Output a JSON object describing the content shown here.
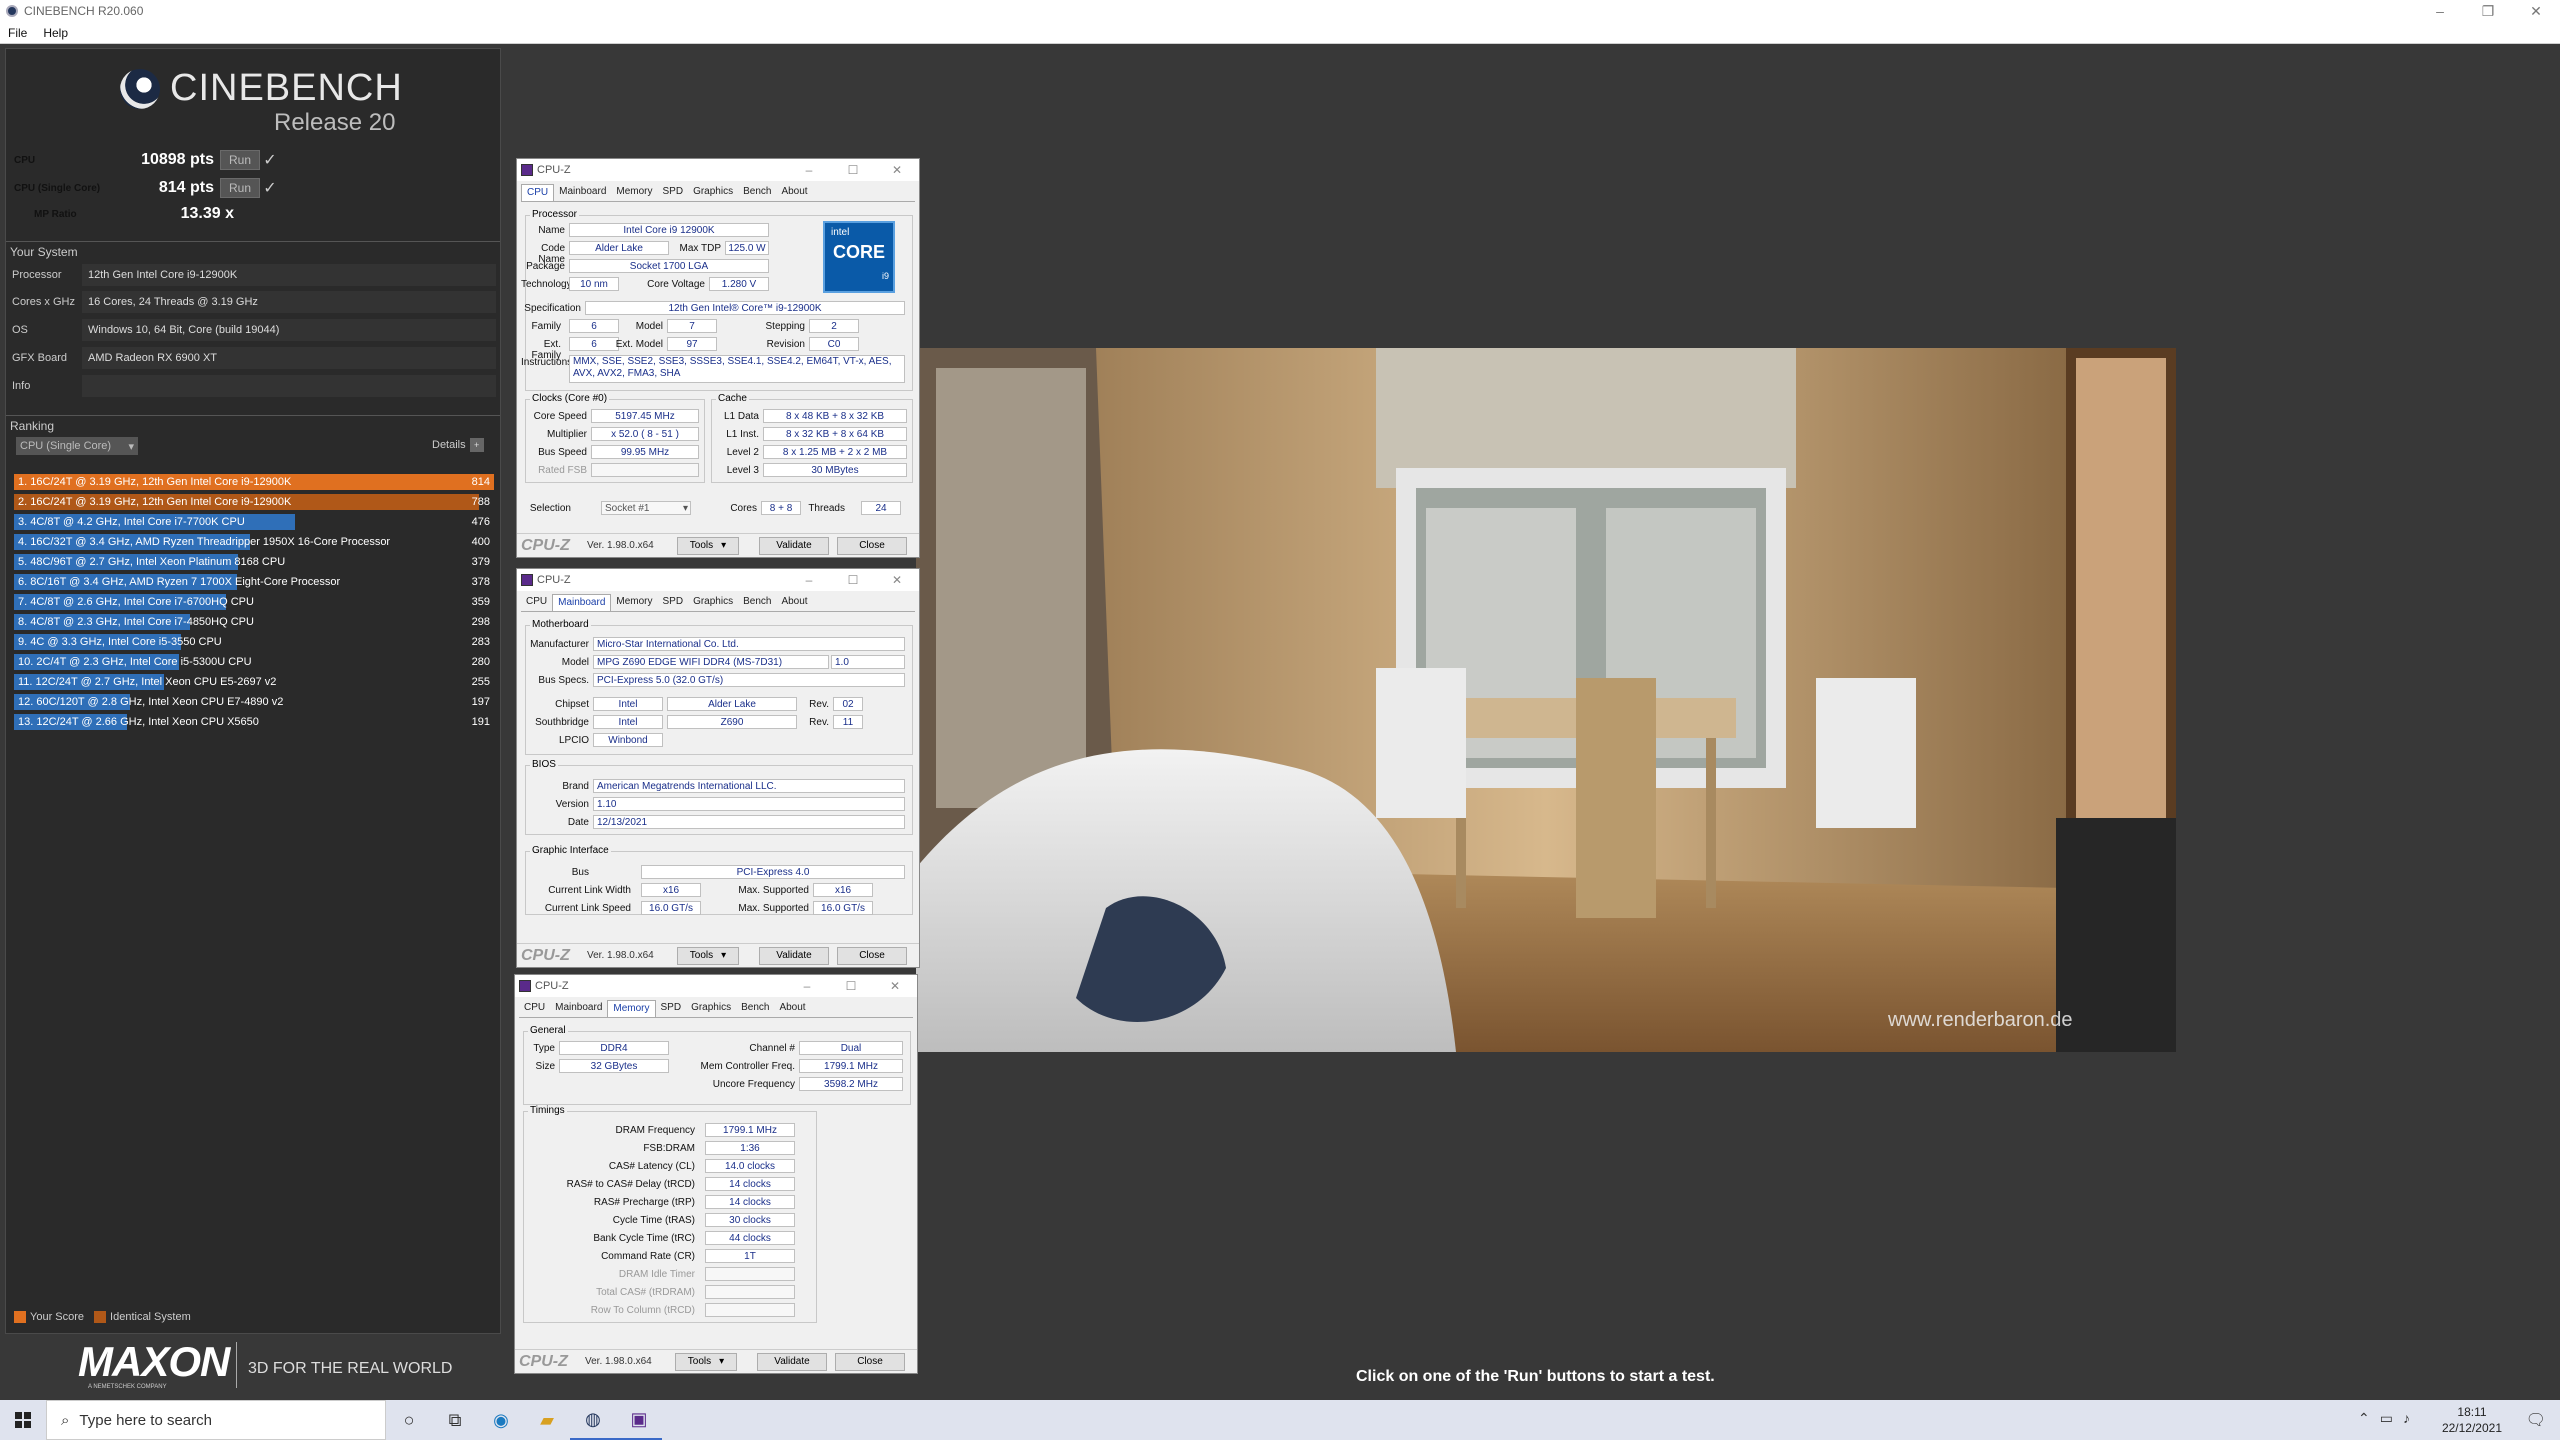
{
  "window": {
    "title": "CINEBENCH R20.060",
    "menu": [
      "File",
      "Help"
    ]
  },
  "cinebench": {
    "logo_title": "CINEBENCH",
    "logo_release": "Release 20",
    "cpu": {
      "label": "CPU",
      "value": "10898 pts",
      "run": "Run"
    },
    "single": {
      "label": "CPU (Single Core)",
      "value": "814 pts",
      "run": "Run"
    },
    "mp": {
      "label": "MP Ratio",
      "value": "13.39 x"
    },
    "your_system": "Your System",
    "system": [
      {
        "k": "Processor",
        "v": "12th Gen Intel Core i9-12900K"
      },
      {
        "k": "Cores x GHz",
        "v": "16 Cores, 24 Threads @ 3.19 GHz"
      },
      {
        "k": "OS",
        "v": "Windows 10, 64 Bit, Core (build 19044)"
      },
      {
        "k": "GFX Board",
        "v": "AMD Radeon RX 6900 XT"
      },
      {
        "k": "Info",
        "v": ""
      }
    ],
    "ranking_title": "Ranking",
    "ranking_select": "CPU (Single Core)",
    "details": "Details",
    "ranking": [
      {
        "text": "1. 16C/24T @ 3.19 GHz, 12th Gen Intel Core i9-12900K",
        "score": "814",
        "frac": 1.0,
        "color": "#e07020"
      },
      {
        "text": "2. 16C/24T @ 3.19 GHz, 12th Gen Intel Core i9-12900K",
        "score": "788",
        "frac": 0.968,
        "color": "#b05818"
      },
      {
        "text": "3. 4C/8T @ 4.2 GHz, Intel Core i7-7700K CPU",
        "score": "476",
        "frac": 0.585,
        "color": "#2f6fb8"
      },
      {
        "text": "4. 16C/32T @ 3.4 GHz, AMD Ryzen Threadripper 1950X 16-Core Processor",
        "score": "400",
        "frac": 0.491,
        "color": "#2f6fb8"
      },
      {
        "text": "5. 48C/96T @ 2.7 GHz, Intel Xeon Platinum 8168 CPU",
        "score": "379",
        "frac": 0.466,
        "color": "#2f6fb8"
      },
      {
        "text": "6. 8C/16T @ 3.4 GHz, AMD Ryzen 7 1700X Eight-Core Processor",
        "score": "378",
        "frac": 0.464,
        "color": "#2f6fb8"
      },
      {
        "text": "7. 4C/8T @ 2.6 GHz, Intel Core i7-6700HQ CPU",
        "score": "359",
        "frac": 0.441,
        "color": "#2f6fb8"
      },
      {
        "text": "8. 4C/8T @ 2.3 GHz, Intel Core i7-4850HQ CPU",
        "score": "298",
        "frac": 0.366,
        "color": "#2f6fb8"
      },
      {
        "text": "9. 4C @ 3.3 GHz, Intel Core i5-3550 CPU",
        "score": "283",
        "frac": 0.348,
        "color": "#2f6fb8"
      },
      {
        "text": "10. 2C/4T @ 2.3 GHz, Intel Core i5-5300U CPU",
        "score": "280",
        "frac": 0.344,
        "color": "#2f6fb8"
      },
      {
        "text": "11. 12C/24T @ 2.7 GHz, Intel Xeon CPU E5-2697 v2",
        "score": "255",
        "frac": 0.313,
        "color": "#2f6fb8"
      },
      {
        "text": "12. 60C/120T @ 2.8 GHz, Intel Xeon CPU E7-4890 v2",
        "score": "197",
        "frac": 0.242,
        "color": "#2f6fb8"
      },
      {
        "text": "13. 12C/24T @ 2.66 GHz, Intel Xeon CPU X5650",
        "score": "191",
        "frac": 0.235,
        "color": "#2f6fb8"
      }
    ],
    "legend_your": "Your Score",
    "legend_identical": "Identical System",
    "maxon": "MAXON",
    "maxon_sub": "A NEMETSCHEK COMPANY",
    "tagline": "3D FOR THE REAL WORLD",
    "status": "Click on one of the 'Run' buttons to start a test.",
    "watermark": "www.renderbaron.de"
  },
  "cpuz_common": {
    "title": "CPU-Z",
    "tabs": [
      "CPU",
      "Mainboard",
      "Memory",
      "SPD",
      "Graphics",
      "Bench",
      "About"
    ],
    "brand": "CPU-Z",
    "version": "Ver. 1.98.0.x64",
    "tools": "Tools",
    "validate": "Validate",
    "close": "Close"
  },
  "cpuz_cpu": {
    "processor": "Processor",
    "name_l": "Name",
    "name": "Intel Core i9 12900K",
    "codename_l": "Code Name",
    "codename": "Alder Lake",
    "tdp_l": "Max TDP",
    "tdp": "125.0 W",
    "package_l": "Package",
    "package": "Socket 1700 LGA",
    "tech_l": "Technology",
    "tech": "10 nm",
    "volt_l": "Core Voltage",
    "volt": "1.280 V",
    "spec_l": "Specification",
    "spec": "12th Gen Intel® Core™ i9-12900K",
    "family_l": "Family",
    "family": "6",
    "model_l": "Model",
    "model": "7",
    "stepping_l": "Stepping",
    "stepping": "2",
    "extfam_l": "Ext. Family",
    "extfam": "6",
    "extmodel_l": "Ext. Model",
    "extmodel": "97",
    "rev_l": "Revision",
    "rev": "C0",
    "instr_l": "Instructions",
    "instr": "MMX, SSE, SSE2, SSE3, SSSE3, SSE4.1, SSE4.2, EM64T, VT-x, AES, AVX, AVX2, FMA3, SHA",
    "clocks": "Clocks (Core #0)",
    "cache": "Cache",
    "corespeed_l": "Core Speed",
    "corespeed": "5197.45 MHz",
    "mult_l": "Multiplier",
    "mult": "x 52.0 ( 8 - 51 )",
    "bus_l": "Bus Speed",
    "bus": "99.95 MHz",
    "ratedfsb_l": "Rated FSB",
    "l1d_l": "L1 Data",
    "l1d": "8 x 48 KB + 8 x 32 KB",
    "l1i_l": "L1 Inst.",
    "l1i": "8 x 32 KB + 8 x 64 KB",
    "l2_l": "Level 2",
    "l2": "8 x 1.25 MB + 2 x 2 MB",
    "l3_l": "Level 3",
    "l3": "30 MBytes",
    "sel_l": "Selection",
    "sel": "Socket #1",
    "cores_l": "Cores",
    "cores": "8 + 8",
    "threads_l": "Threads",
    "threads": "24",
    "intel_badge1": "intel",
    "intel_badge2": "CORE",
    "intel_badge3": "i9"
  },
  "cpuz_mb": {
    "motherboard": "Motherboard",
    "manu_l": "Manufacturer",
    "manu": "Micro-Star International Co. Ltd.",
    "model_l": "Model",
    "model": "MPG Z690 EDGE WIFI DDR4 (MS-7D31)",
    "model_rev": "1.0",
    "busspec_l": "Bus Specs.",
    "busspec": "PCI-Express 5.0 (32.0 GT/s)",
    "chipset_l": "Chipset",
    "chipset1": "Intel",
    "chipset2": "Alder Lake",
    "rev_l": "Rev.",
    "chipset_rev": "02",
    "south_l": "Southbridge",
    "south1": "Intel",
    "south2": "Z690",
    "south_rev": "11",
    "lpcio_l": "LPCIO",
    "lpcio": "Winbond",
    "bios": "BIOS",
    "brand_l": "Brand",
    "brand": "American Megatrends International LLC.",
    "ver_l": "Version",
    "ver": "1.10",
    "date_l": "Date",
    "date": "12/13/2021",
    "gi": "Graphic Interface",
    "gbus_l": "Bus",
    "gbus": "PCI-Express 4.0",
    "clw_l": "Current Link Width",
    "clw": "x16",
    "msup_l": "Max. Supported",
    "msup": "x16",
    "cls_l": "Current Link Speed",
    "cls": "16.0 GT/s",
    "msup2": "16.0 GT/s"
  },
  "cpuz_mem": {
    "general": "General",
    "type_l": "Type",
    "type": "DDR4",
    "chan_l": "Channel #",
    "chan": "Dual",
    "size_l": "Size",
    "size": "32 GBytes",
    "mcf_l": "Mem Controller Freq.",
    "mcf": "1799.1 MHz",
    "uncore_l": "Uncore Frequency",
    "uncore": "3598.2 MHz",
    "timings": "Timings",
    "rows": [
      {
        "k": "DRAM Frequency",
        "v": "1799.1 MHz"
      },
      {
        "k": "FSB:DRAM",
        "v": "1:36"
      },
      {
        "k": "CAS# Latency (CL)",
        "v": "14.0 clocks"
      },
      {
        "k": "RAS# to CAS# Delay (tRCD)",
        "v": "14 clocks"
      },
      {
        "k": "RAS# Precharge (tRP)",
        "v": "14 clocks"
      },
      {
        "k": "Cycle Time (tRAS)",
        "v": "30 clocks"
      },
      {
        "k": "Bank Cycle Time (tRC)",
        "v": "44 clocks"
      },
      {
        "k": "Command Rate (CR)",
        "v": "1T"
      },
      {
        "k": "DRAM Idle Timer",
        "v": ""
      },
      {
        "k": "Total CAS# (tRDRAM)",
        "v": ""
      },
      {
        "k": "Row To Column (tRCD)",
        "v": ""
      }
    ]
  },
  "taskbar": {
    "search": "Type here to search",
    "time": "18:11",
    "date": "22/12/2021"
  }
}
